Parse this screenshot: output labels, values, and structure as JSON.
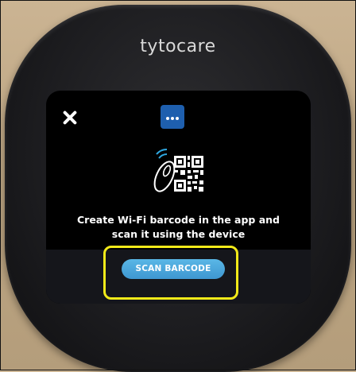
{
  "device": {
    "brand": "tytocare"
  },
  "screen": {
    "close_icon": "close-icon",
    "menu_icon": "more-options-icon",
    "illustration": "device-scanning-qr-icon",
    "message_line1": "Create Wi-Fi barcode in the app and",
    "message_line2": "scan it using the device",
    "scan_button_label": "SCAN BARCODE"
  },
  "colors": {
    "screen_bg": "#000000",
    "menu_accent": "#1e5fae",
    "button": "#4aa7dc",
    "highlight": "#f2ea19"
  }
}
